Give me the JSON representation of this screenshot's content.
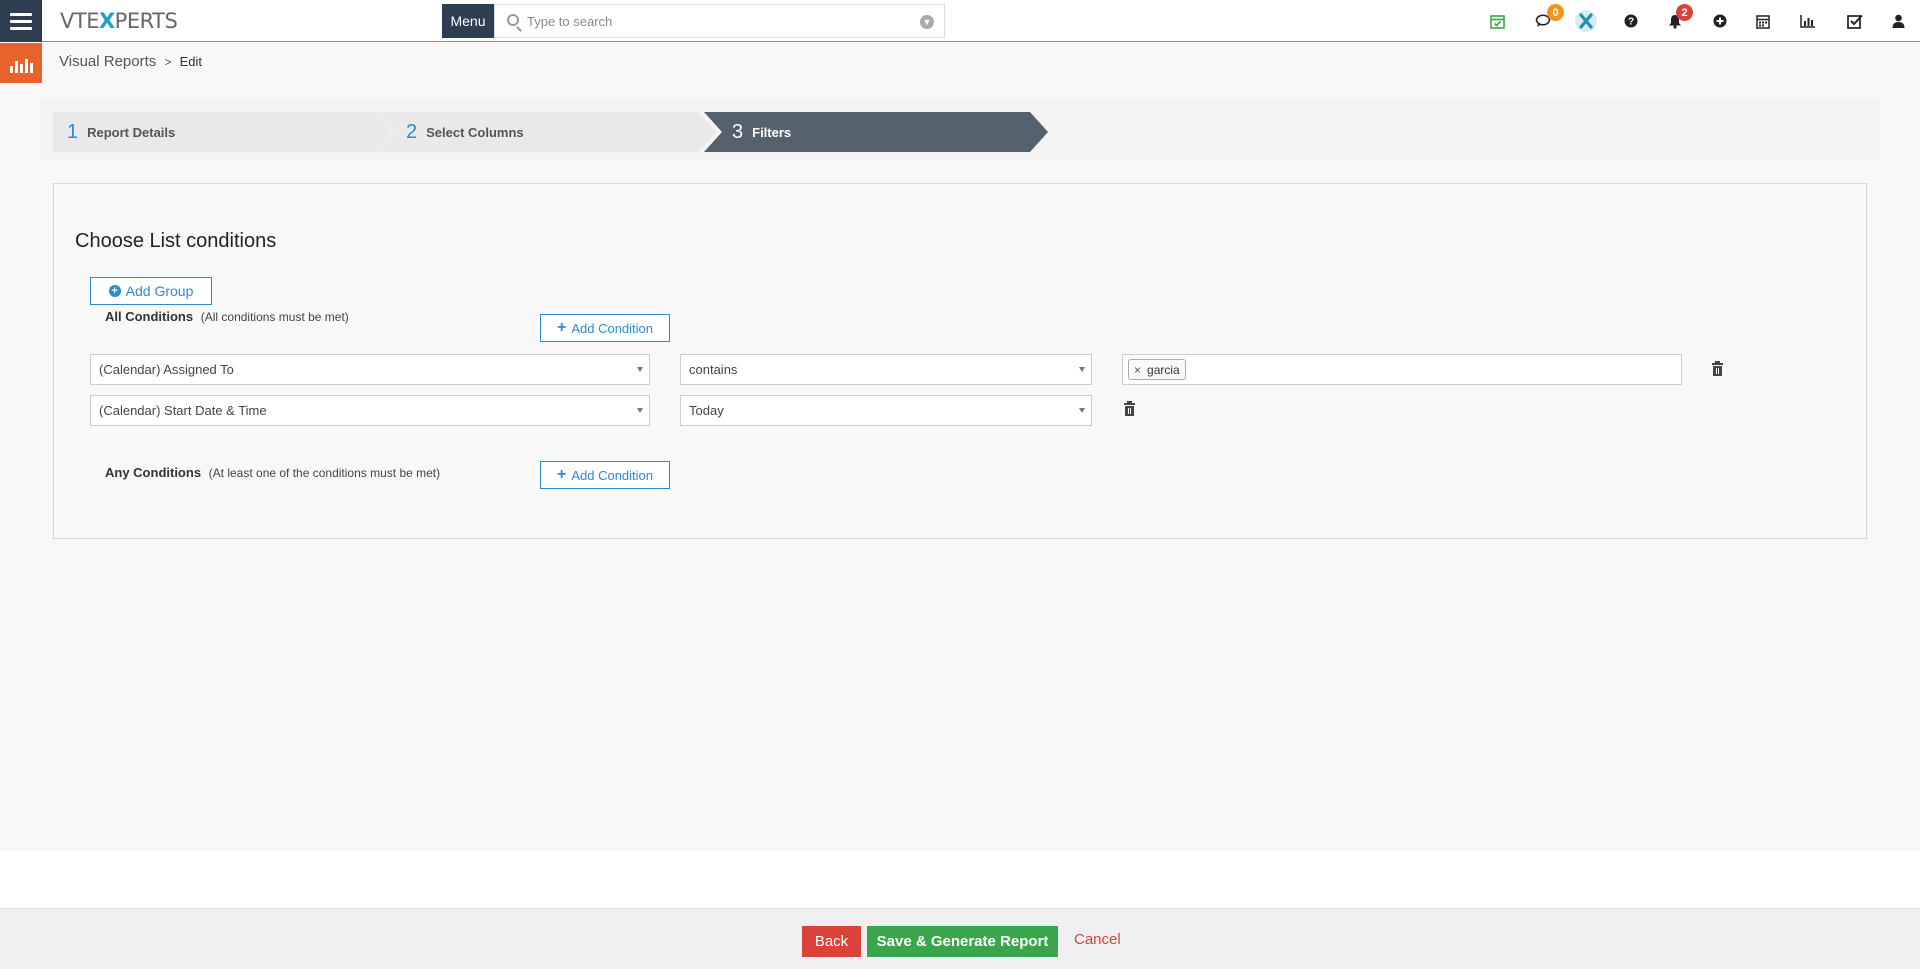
{
  "header": {
    "logo_prefix": "VTE",
    "logo_x": "X",
    "logo_suffix": "PERTS",
    "menu_label": "Menu",
    "search_placeholder": "Type to search",
    "chat_badge": "0",
    "notifications_badge": "2",
    "badge_colors": {
      "chat": "#f0961a",
      "notifications": "#d9433a"
    }
  },
  "breadcrumb": {
    "module": "Visual Reports",
    "separator": ">",
    "page": "Edit"
  },
  "wizard": {
    "steps": [
      {
        "number": "1",
        "label": "Report Details"
      },
      {
        "number": "2",
        "label": "Select Columns"
      },
      {
        "number": "3",
        "label": "Filters"
      }
    ],
    "active_step": 3
  },
  "filters": {
    "title": "Choose List conditions",
    "add_group_label": "Add Group",
    "all_conditions": {
      "label": "All Conditions",
      "hint": "(All conditions must be met)",
      "add_label": "Add Condition",
      "rows": [
        {
          "field": "(Calendar) Assigned To",
          "operator": "contains",
          "value_tag": "garcia"
        },
        {
          "field": "(Calendar) Start Date & Time",
          "operator": "Today"
        }
      ]
    },
    "any_conditions": {
      "label": "Any Conditions",
      "hint": "(At least one of the conditions must be met)",
      "add_label": "Add Condition"
    }
  },
  "footer": {
    "back_label": "Back",
    "save_label": "Save & Generate Report",
    "cancel_label": "Cancel"
  }
}
